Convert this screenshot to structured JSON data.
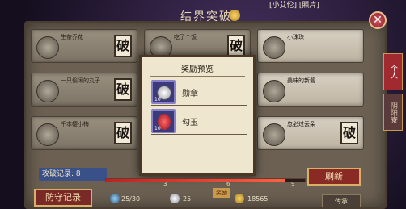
{
  "header": {
    "title": "结界突破",
    "top_link": "[小艾伦] [照片]",
    "close_label": "✕"
  },
  "side_tabs": [
    {
      "label": "个人",
      "active": true
    },
    {
      "label": "阴阳寮",
      "active": false
    }
  ],
  "cards": [
    {
      "name": "生茶乔花",
      "badge": "破"
    },
    {
      "name": "吃了个饭",
      "badge": "破"
    },
    {
      "name": "小珠珠",
      "badge": ""
    },
    {
      "name": "一只偷闲的丸子",
      "badge": "破"
    },
    {
      "name": "",
      "badge": ""
    },
    {
      "name": "美味的新酱",
      "badge": ""
    },
    {
      "name": "千本樱小梅",
      "badge": "破"
    },
    {
      "name": "",
      "badge": ""
    },
    {
      "name": "忽必过云朵",
      "badge": "破"
    }
  ],
  "popup": {
    "title": "奖励预览",
    "rewards": [
      {
        "label": "勋章",
        "count": "10",
        "icon": "medal-icon"
      },
      {
        "label": "勾玉",
        "count": "10",
        "icon": "magatama-icon"
      }
    ]
  },
  "bottom": {
    "record_label": "攻破记录: 8",
    "refresh_label": "刷新",
    "defense_label": "防守记录",
    "progress_fraction": 0.9,
    "progress_marks": [
      "3",
      "6",
      "9"
    ],
    "ticket_count": "25/30",
    "medal_count": "25",
    "seal_label": "奖励",
    "coin_count": "18565",
    "inherit_label": "传承"
  },
  "colors": {
    "accent_red": "#8a2a24",
    "gold": "#d8b06a",
    "parchment": "#efe6cf"
  }
}
